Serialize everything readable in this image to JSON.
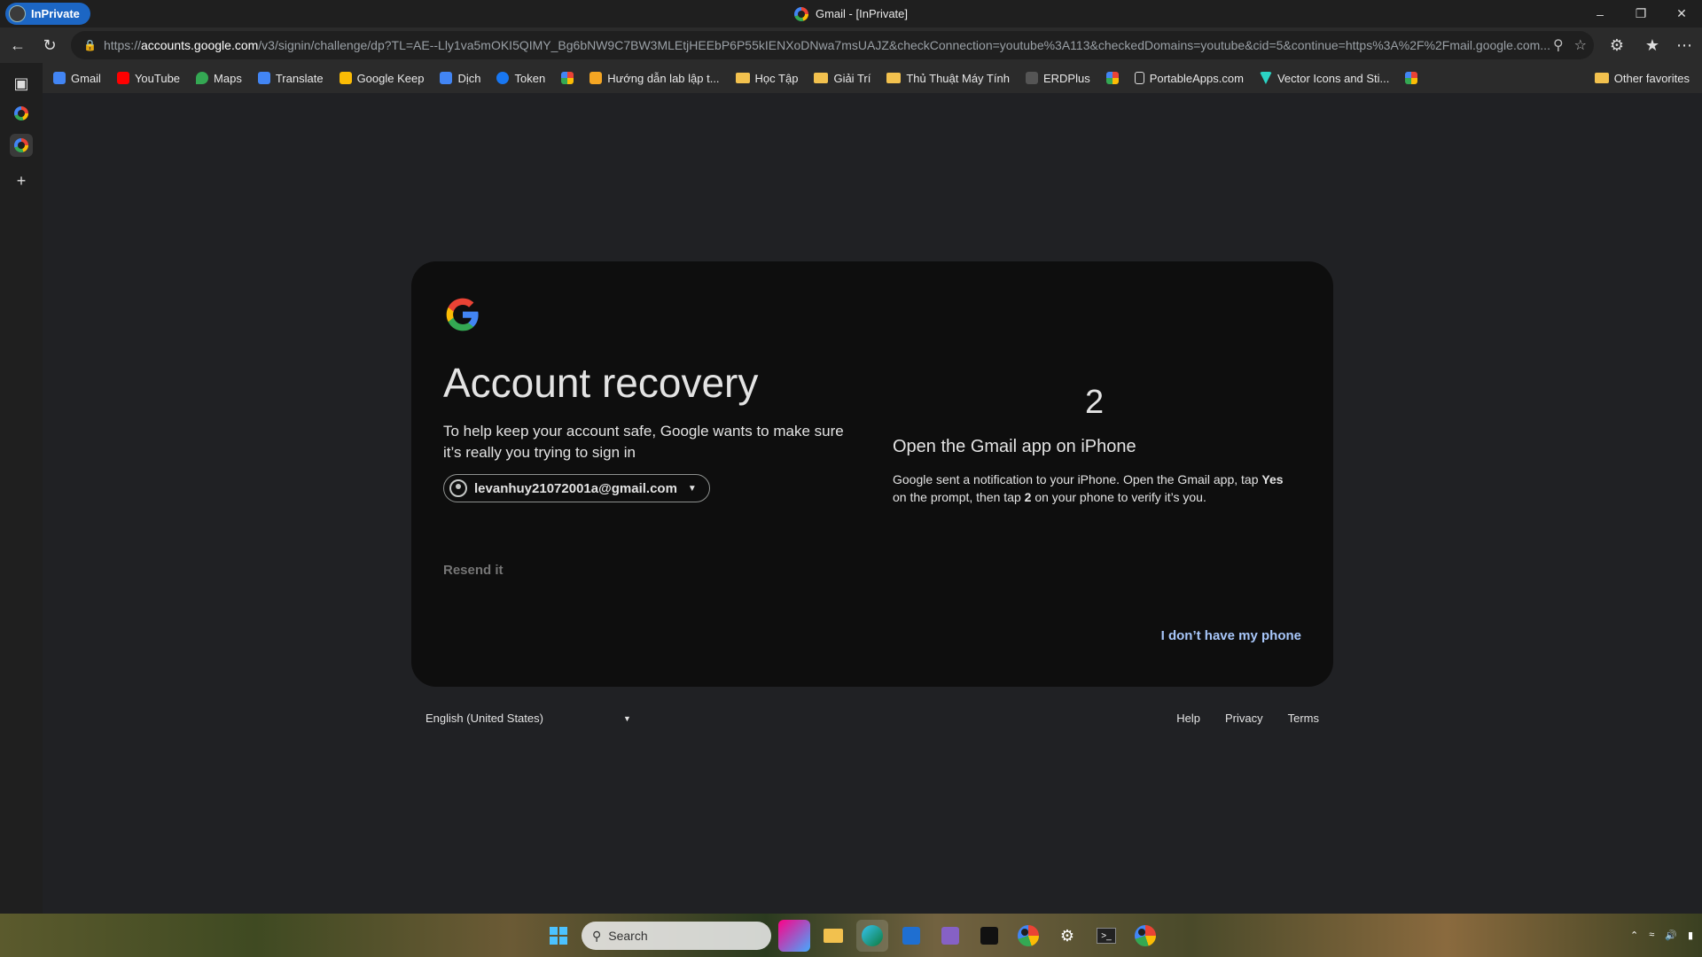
{
  "window": {
    "inprivate_label": "InPrivate",
    "title": "Gmail - [InPrivate]"
  },
  "address_bar": {
    "scheme": "https://",
    "host": "accounts.google.com",
    "path": "/v3/signin/challenge/dp?TL=AE--Lly1va5mOKI5QIMY_Bg6bNW9C7BW3MLEtjHEEbP6P55kIENXoDNwa7msUAJZ&checkConnection=youtube%3A113&checkedDomains=youtube&cid=5&continue=https%3A%2F%2Fmail.google.com..."
  },
  "bookmarks": [
    {
      "label": "Gmail",
      "icon": "gmail-icon",
      "color": "#4285f4"
    },
    {
      "label": "YouTube",
      "icon": "youtube-icon",
      "color": "#ff0000"
    },
    {
      "label": "Maps",
      "icon": "maps-icon",
      "color": "#34a853"
    },
    {
      "label": "Translate",
      "icon": "translate-icon",
      "color": "#4285f4"
    },
    {
      "label": "Google Keep",
      "icon": "keep-icon",
      "color": "#fbbc05"
    },
    {
      "label": "Dịch",
      "icon": "translate-icon",
      "color": "#4285f4"
    },
    {
      "label": "Token",
      "icon": "facebook-icon",
      "color": "#1877f2"
    },
    {
      "label": "",
      "icon": "pinwheel-icon",
      "color": "#34a853"
    },
    {
      "label": "Hướng dẫn lab lập t...",
      "icon": "a-icon",
      "color": "#f5a623"
    },
    {
      "label": "Học Tập",
      "icon": "folder-icon",
      "color": "#f2c14e"
    },
    {
      "label": "Giải Trí",
      "icon": "folder-icon",
      "color": "#f2c14e"
    },
    {
      "label": "Thủ Thuật Máy Tính",
      "icon": "folder-icon",
      "color": "#f2c14e"
    },
    {
      "label": "ERDPlus",
      "icon": "er-icon",
      "color": "#555555"
    },
    {
      "label": "",
      "icon": "pinwheel-icon",
      "color": "#34a853"
    },
    {
      "label": "PortableApps.com",
      "icon": "page-icon",
      "color": "#dddddd"
    },
    {
      "label": "Vector Icons and Sti...",
      "icon": "vector-icon",
      "color": "#2bd4c5"
    },
    {
      "label": "",
      "icon": "pinwheel-icon",
      "color": "#34a853"
    }
  ],
  "other_favorites": "Other favorites",
  "card": {
    "title": "Account recovery",
    "subtitle": "To help keep your account safe, Google wants to make sure it’s really you trying to sign in",
    "account_email": "levanhuy21072001a@gmail.com",
    "resend": "Resend it",
    "number": "2",
    "open_title": "Open the Gmail app on iPhone",
    "open_desc_1": "Google sent a notification to your iPhone. Open the Gmail app, tap ",
    "open_desc_yes": "Yes",
    "open_desc_2": " on the prompt, then tap ",
    "open_desc_num": "2",
    "open_desc_3": " on your phone to verify it’s you.",
    "no_phone": "I don’t have my phone"
  },
  "footer": {
    "language": "English (United States)",
    "help": "Help",
    "privacy": "Privacy",
    "terms": "Terms"
  },
  "taskbar": {
    "search_placeholder": "Search"
  }
}
